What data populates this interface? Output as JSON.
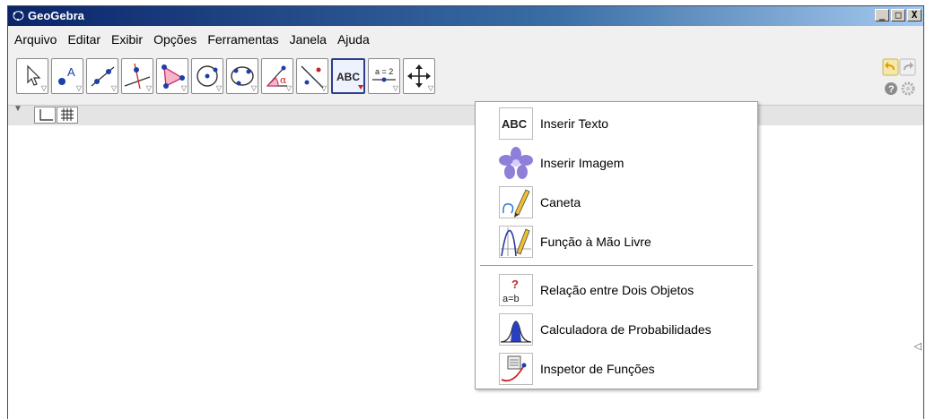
{
  "window": {
    "title": "GeoGebra"
  },
  "window_buttons": {
    "minimize": "_",
    "maximize": "□",
    "close": "X"
  },
  "menu": [
    "Arquivo",
    "Editar",
    "Exibir",
    "Opções",
    "Ferramentas",
    "Janela",
    "Ajuda"
  ],
  "toolbar": {
    "tools": [
      {
        "icon": "move-cursor-icon"
      },
      {
        "icon": "point-icon",
        "text": "A"
      },
      {
        "icon": "line-icon"
      },
      {
        "icon": "perpendicular-line-icon"
      },
      {
        "icon": "polygon-icon"
      },
      {
        "icon": "circle-icon"
      },
      {
        "icon": "conic-icon"
      },
      {
        "icon": "angle-icon",
        "text": "α"
      },
      {
        "icon": "reflect-icon"
      },
      {
        "icon": "text-icon",
        "text": "ABC"
      },
      {
        "icon": "slider-icon",
        "text": "a = 2"
      },
      {
        "icon": "move-graphics-view-icon"
      }
    ],
    "undo_icon": "undo-icon",
    "redo_icon": "redo-icon",
    "help_icon": "help-icon",
    "settings_icon": "gear-icon"
  },
  "style_bar": {
    "axes_icon": "axes-icon",
    "grid_icon": "grid-icon"
  },
  "dropdown": {
    "items": [
      {
        "label": "Inserir Texto",
        "icon": "abc-text-icon",
        "icon_text": "ABC"
      },
      {
        "label": "Inserir Imagem",
        "icon": "image-flower-icon"
      },
      {
        "label": "Caneta",
        "icon": "pen-icon"
      },
      {
        "label": "Função à Mão Livre",
        "icon": "freehand-function-icon"
      },
      {
        "label": "Relação entre Dois Objetos",
        "icon": "relation-icon",
        "icon_text_top": "?",
        "icon_text_bottom": "a=b"
      },
      {
        "label": "Calculadora de Probabilidades",
        "icon": "probability-calculator-icon"
      },
      {
        "label": "Inspetor de Funções",
        "icon": "function-inspector-icon"
      }
    ]
  },
  "colors": {
    "titlebar_start": "#0a246a",
    "titlebar_end": "#a6caf0",
    "active_tool_border": "#2b3f8c",
    "accent_red": "#cc2222",
    "accent_blue": "#1c3fa8"
  }
}
